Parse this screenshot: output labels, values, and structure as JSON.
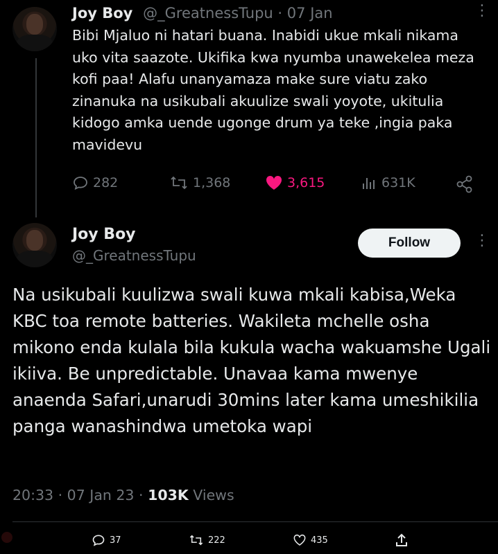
{
  "tweet1": {
    "name": "Joy Boy",
    "handle": "@_GreatnessTupu",
    "separator": "·",
    "date": "07 Jan",
    "text": "Bibi Mjaluo ni hatari buana. Inabidi ukue mkali nikama uko vita saazote. Ukifika kwa nyumba unawekelea meza kofi paa! Alafu unanyamaza make sure viatu zako zinanuka na usikubali akuulize swali yoyote, ukitulia kidogo amka uende ugonge drum ya teke ,ingia paka mavidevu",
    "replies": "282",
    "retweets": "1,368",
    "likes": "3,615",
    "views": "631K"
  },
  "tweet2": {
    "name": "Joy Boy",
    "handle": "@_GreatnessTupu",
    "follow_label": "Follow",
    "text": "Na usikubali kuulizwa swali kuwa mkali kabisa,Weka KBC toa remote batteries. Wakileta mchelle osha mikono enda kulala bila kukula wacha wakuamshe Ugali ikiiva. Be unpredictable. Unavaa kama mwenye anaenda Safari,unarudi 30mins later kama umeshikilia panga wanashindwa umetoka wapi",
    "time": "20:33",
    "separator": "·",
    "date": "07 Jan 23",
    "views_count": "103K",
    "views_label": "Views"
  },
  "bottom_bar": {
    "replies": "37",
    "retweets": "222",
    "likes": "435"
  },
  "colors": {
    "background": "#000000",
    "text": "#e7e9ea",
    "muted": "#71767b",
    "like": "#f91880",
    "follow_bg": "#eff3f4"
  }
}
